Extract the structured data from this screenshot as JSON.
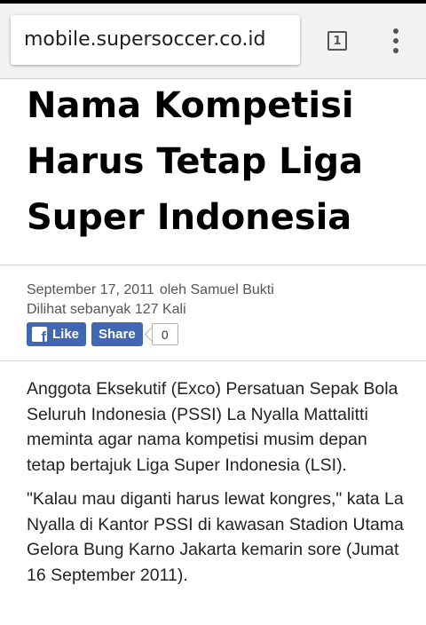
{
  "browser": {
    "url": "mobile.supersoccer.co.id",
    "tab_count": "1",
    "tabs_icon": "tabs-icon",
    "menu_icon": "overflow-menu-icon"
  },
  "article": {
    "title": "Nama Kompetisi Harus Tetap Liga Super Indonesia",
    "date": "September 17, 2011",
    "author": "oleh Samuel Bukti",
    "views": "Dilihat sebanyak 127 Kali",
    "paragraphs": [
      "Anggota Eksekutif (Exco) Persatuan Sepak Bola Seluruh Indonesia (PSSI) La Nyalla Mattalitti meminta agar nama kompetisi musim depan tetap bertajuk Liga Super Indonesia (LSI).",
      "\"Kalau mau diganti harus lewat kongres,\" kata La Nyalla di Kantor PSSI di kawasan Stadion Utama Gelora Bung Karno Jakarta kemarin sore (Jumat 16 September 2011)."
    ]
  },
  "social": {
    "like_label": "Like",
    "share_label": "Share",
    "count": "0",
    "brand_color": "#4267b2"
  }
}
